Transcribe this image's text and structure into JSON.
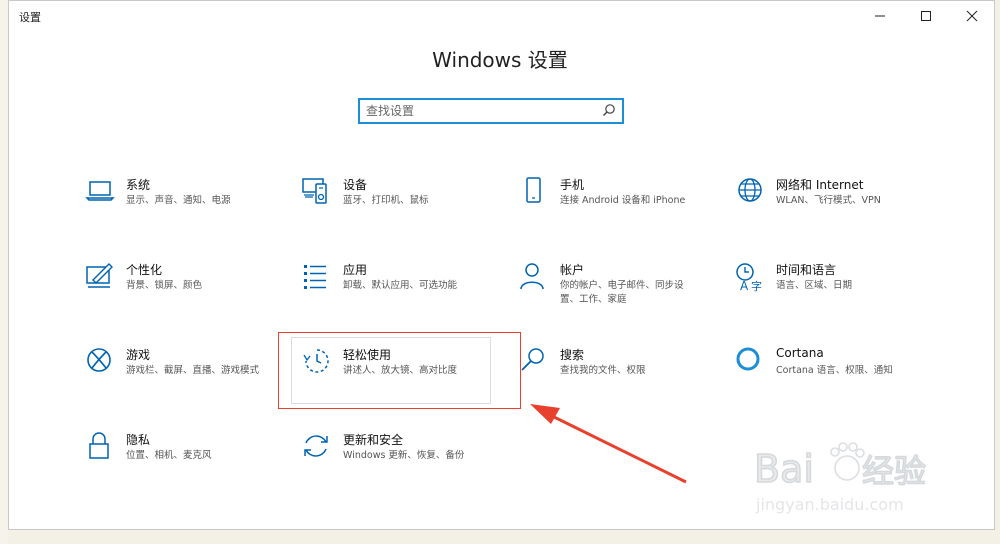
{
  "window": {
    "title": "设置",
    "heading": "Windows 设置",
    "colors": {
      "accent": "#0063b1",
      "search_border": "#1a8fd8",
      "highlight": "#e8402c"
    }
  },
  "search": {
    "placeholder": "查找设置"
  },
  "tiles": [
    {
      "name": "系统",
      "desc": "显示、声音、通知、电源",
      "icon": "laptop-icon"
    },
    {
      "name": "设备",
      "desc": "蓝牙、打印机、鼠标",
      "icon": "devices-icon"
    },
    {
      "name": "手机",
      "desc": "连接 Android 设备和 iPhone",
      "icon": "phone-icon"
    },
    {
      "name": "网络和 Internet",
      "desc": "WLAN、飞行模式、VPN",
      "icon": "globe-icon"
    },
    {
      "name": "个性化",
      "desc": "背景、锁屏、颜色",
      "icon": "personalization-icon"
    },
    {
      "name": "应用",
      "desc": "卸载、默认应用、可选功能",
      "icon": "apps-list-icon"
    },
    {
      "name": "帐户",
      "desc": "你的帐户、电子邮件、同步设\n置、工作、家庭",
      "icon": "person-icon"
    },
    {
      "name": "时间和语言",
      "desc": "语言、区域、日期",
      "icon": "time-language-icon"
    },
    {
      "name": "游戏",
      "desc": "游戏栏、截屏、直播、游戏模式",
      "icon": "xbox-icon"
    },
    {
      "name": "轻松使用",
      "desc": "讲述人、放大镜、高对比度",
      "icon": "ease-of-access-icon"
    },
    {
      "name": "搜索",
      "desc": "查找我的文件、权限",
      "icon": "search-magnifier-icon"
    },
    {
      "name": "Cortana",
      "desc": "Cortana 语言、权限、通知",
      "icon": "cortana-icon"
    },
    {
      "name": "隐私",
      "desc": "位置、相机、麦克风",
      "icon": "lock-icon"
    },
    {
      "name": "更新和安全",
      "desc": "Windows 更新、恢复、备份",
      "icon": "update-icon"
    }
  ],
  "watermark": {
    "brand": "Bai",
    "brand2": "du",
    "brand_cn": "经验",
    "url": "jingyan.baidu.com"
  }
}
